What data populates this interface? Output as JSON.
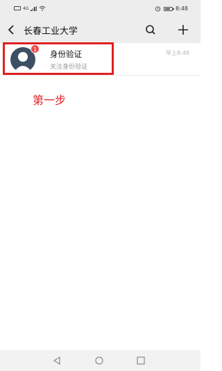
{
  "status_bar": {
    "network": "4G",
    "time": "8:48"
  },
  "header": {
    "title": "长春工业大学",
    "icons": [
      "back-icon",
      "search-icon",
      "add-icon"
    ]
  },
  "chat_list": [
    {
      "title": "身份验证",
      "preview": "关注身份验证",
      "time": "早上8:48",
      "unread": "1",
      "avatar": "default-avatar-icon"
    }
  ],
  "annotation": {
    "step_label": "第一步",
    "highlight_color": "#e02020"
  },
  "system_nav": {
    "icons": [
      "triangle-back-icon",
      "circle-home-icon",
      "square-recent-icon"
    ]
  }
}
